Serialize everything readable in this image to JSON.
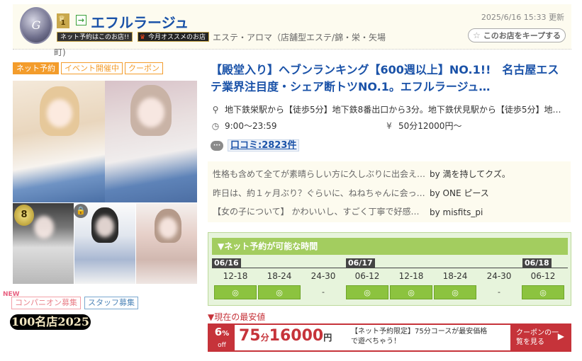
{
  "header": {
    "logo_icon": "shop-logo-icon",
    "rank_number": "1",
    "rank_icon": "crown-icon",
    "enter_icon": "arrow-enter-icon",
    "shop_name": "エフルラージュ",
    "updated": "2025/6/16 15:33 更新",
    "banner_net": "ネット予約はこのお店!!",
    "banner_today": "今月オススメのお店",
    "category": "エステ・アロマ（店舗型エステ/錦・栄・矢場",
    "category_wrap": "町)",
    "keep_button": "このお店をキープする",
    "keep_icon": "star-icon"
  },
  "tags": [
    "ネット予約",
    "イベント開催中",
    "クーポン"
  ],
  "photos": {
    "medal_text": "8",
    "lock_icon": "lock-icon"
  },
  "recruit": {
    "companion": "コンパニオン募集",
    "staff": "スタッフ募集",
    "new_mark": "NEW",
    "ranking_logo": "100名店2025"
  },
  "main": {
    "title": "【殿堂入り】ヘブンランキング【600週以上】NO.1!!　名古屋エステ業界注目度・シェア断トツNO.1。エフルラージュ…",
    "access": "地下鉄栄駅から【徒歩5分】地下鉄8番出口から3分。地下鉄伏見駅から【徒歩5分】地…",
    "hours": "9:00〜23:59",
    "price": "50分12000円〜",
    "review_label": "口コミ:2823件"
  },
  "reviews": [
    {
      "text": "性格も含めて全てが素晴らしい方に久しぶりに出会え…",
      "by": "by 満を持してクズ。"
    },
    {
      "text": "昨日は、約１ヶ月ぶり？ぐらいに、ねねちゃんに会っ…",
      "by": "by ONE ピース"
    },
    {
      "text": "【女の子について】 かわいいし、すごく丁寧で好感…",
      "by": "by misfits_pi"
    }
  ],
  "schedule": {
    "heading": "▼ネット予約が可能な時間",
    "dates": [
      "06/16",
      "06/17",
      "06/18"
    ],
    "slots": [
      {
        "time": "12-18",
        "mark": "◎",
        "available": true
      },
      {
        "time": "18-24",
        "mark": "◎",
        "available": true
      },
      {
        "time": "24-30",
        "mark": "-",
        "available": false
      },
      {
        "time": "06-12",
        "mark": "◎",
        "available": true
      },
      {
        "time": "12-18",
        "mark": "◎",
        "available": true
      },
      {
        "time": "18-24",
        "mark": "◎",
        "available": true
      },
      {
        "time": "24-30",
        "mark": "-",
        "available": false
      },
      {
        "time": "06-12",
        "mark": "◎",
        "available": true
      }
    ]
  },
  "coupon": {
    "lowest_label": "▼現在の最安値",
    "percent": "6",
    "percent_sign": "%",
    "off": "off",
    "minutes": "75",
    "minutes_unit": "分",
    "price": "16000",
    "yen": "円",
    "desc": "【ネット予約限定】75分コースが最安価格で遊べちゃう！",
    "button": "クーポンの一覧を見る",
    "button_arrow": "▶"
  },
  "colors": {
    "link_blue": "#1a52a8",
    "accent_orange": "#f39c2b",
    "schedule_green": "#a3cd5f",
    "coupon_red": "#c6333a"
  }
}
